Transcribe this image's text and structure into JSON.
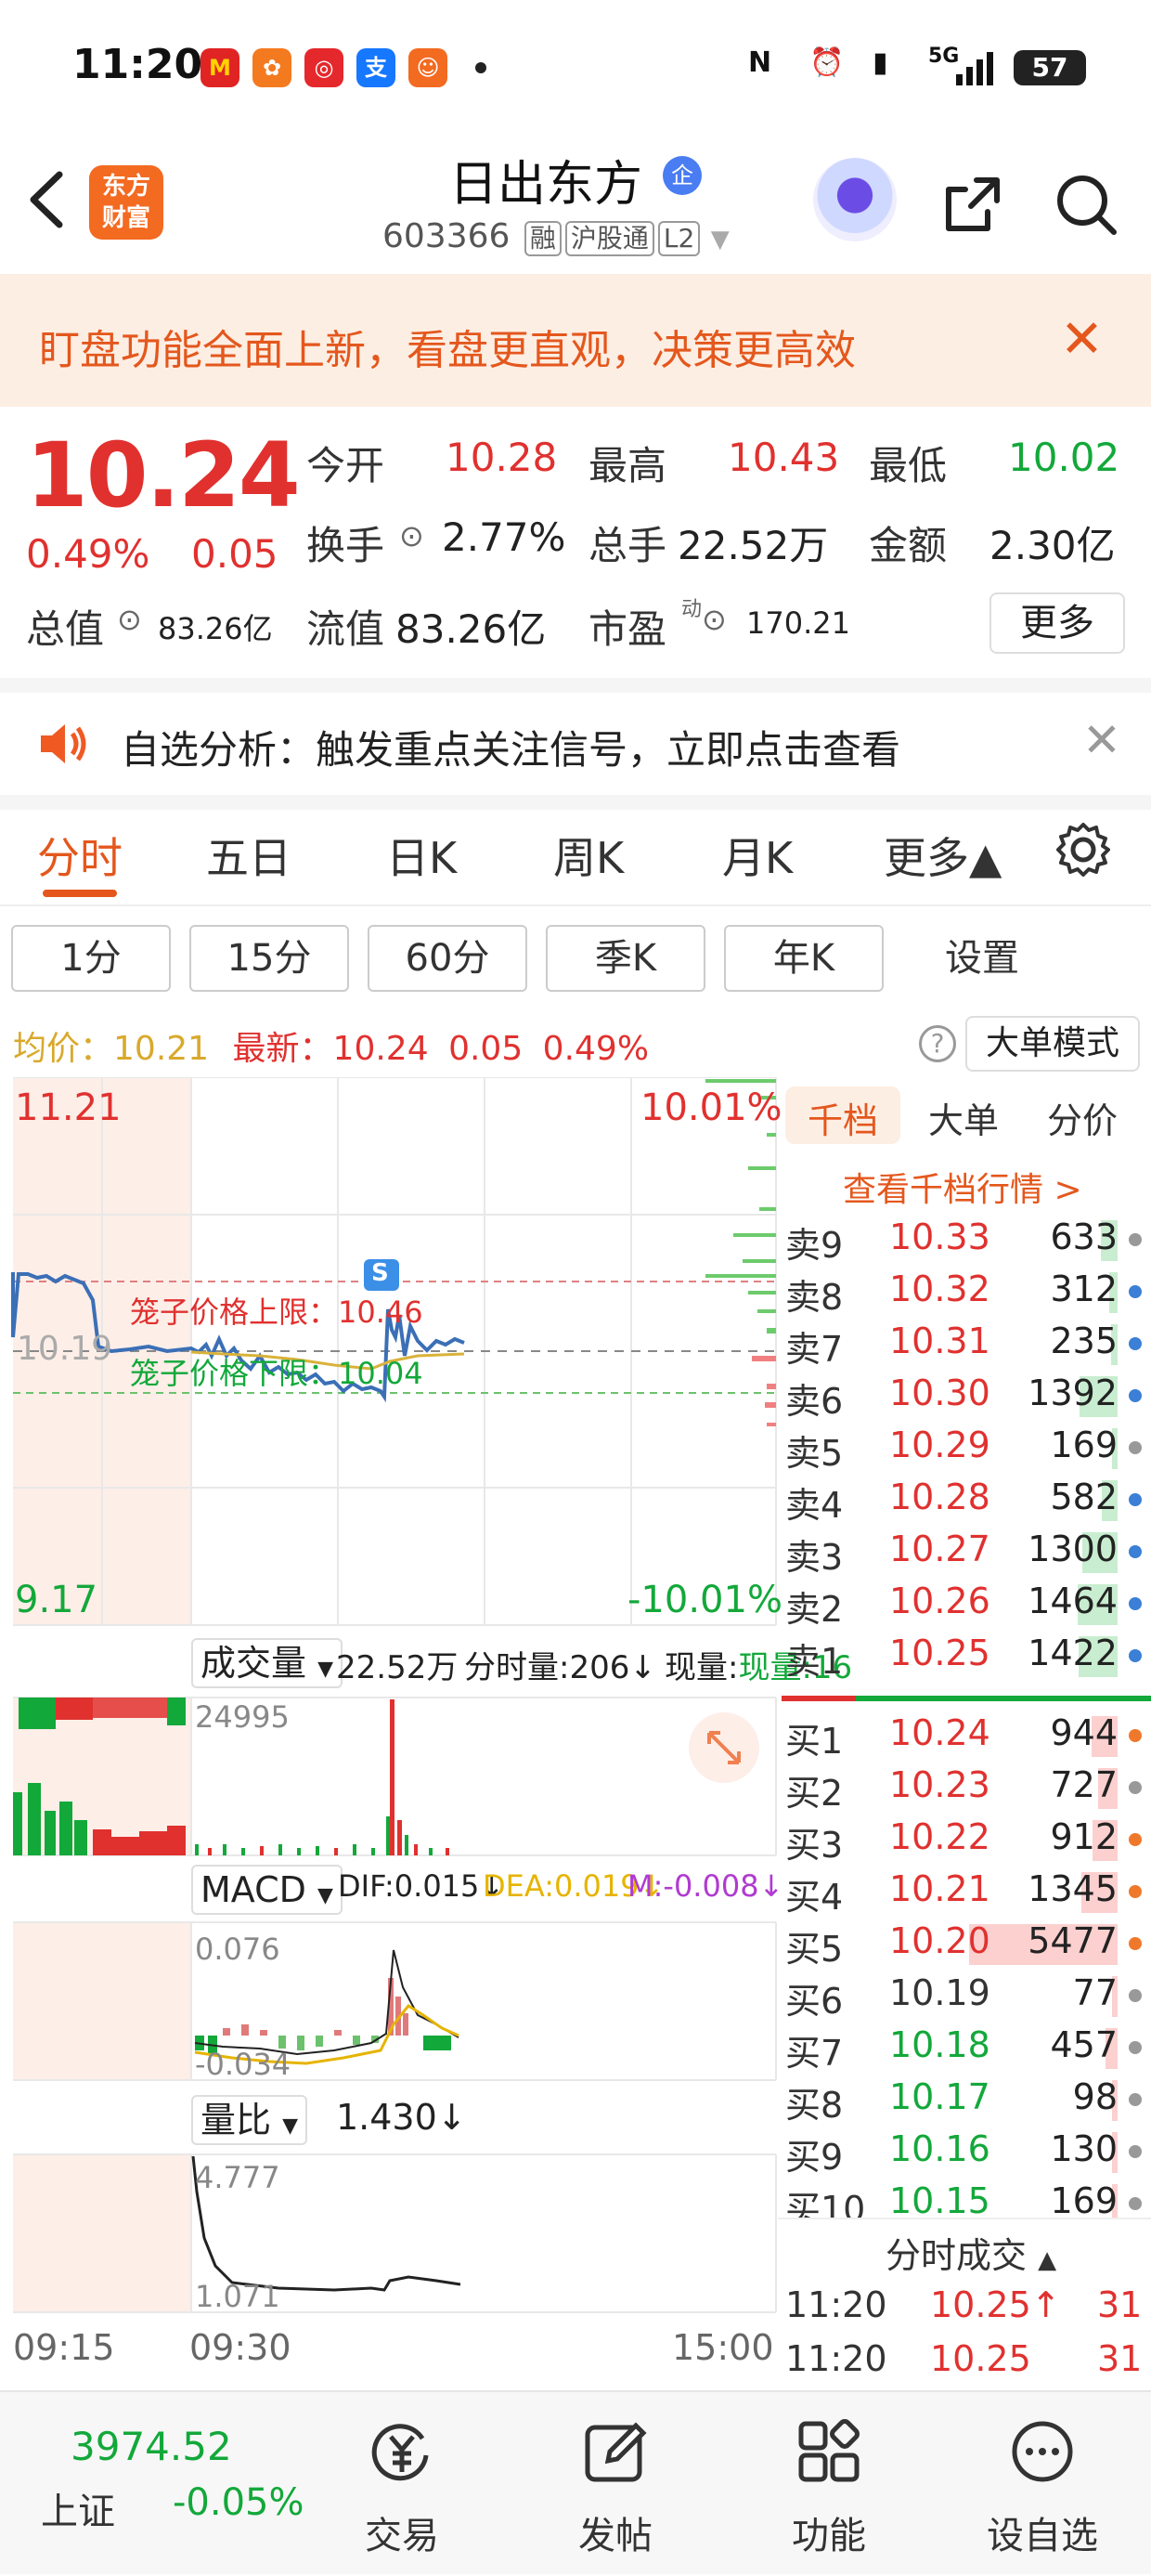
{
  "status_bar": {
    "time": "11:20",
    "battery": "57",
    "network": "5G"
  },
  "header": {
    "logo_text": [
      "东方",
      "财富"
    ],
    "stock_name": "日出东方",
    "badge": "企",
    "code": "603366",
    "tags": [
      "融",
      "沪股通",
      "L2"
    ]
  },
  "banner": {
    "text": "盯盘功能全面上新，看盘更直观，决策更高效"
  },
  "quote": {
    "price": "10.24",
    "pct": "0.49%",
    "change": "0.05",
    "open_label": "今开",
    "open": "10.28",
    "high_label": "最高",
    "high": "10.43",
    "low_label": "最低",
    "low": "10.02",
    "turnover_label": "换手",
    "turnover": "2.77%",
    "volume_label": "总手",
    "volume": "22.52万",
    "amount_label": "金额",
    "amount": "2.30亿",
    "mktcap_label": "总值",
    "mktcap": "83.26亿",
    "float_label": "流值",
    "float": "83.26亿",
    "pe_label": "市盈",
    "pe_sup": "动",
    "pe": "170.21",
    "more_label": "更多"
  },
  "notice": {
    "text": "自选分析：触发重点关注信号，立即点击查看"
  },
  "tabs": [
    "分时",
    "五日",
    "日K",
    "周K",
    "月K",
    "更多▲"
  ],
  "sub_tabs": [
    "1分",
    "15分",
    "60分",
    "季K",
    "年K",
    "设置"
  ],
  "avg_line": {
    "avg_label": "均价：",
    "avg": "10.21",
    "latest_label": "最新：",
    "latest": "10.24",
    "change": "0.05",
    "pct": "0.49%",
    "big_order_btn": "大单模式"
  },
  "chart": {
    "top_price": "11.21",
    "top_pct": "10.01%",
    "bottom_price": "9.17",
    "bottom_pct": "-10.01%",
    "prev_close": "10.19",
    "cage_upper": "笼子价格上限：10.46",
    "cage_lower": "笼子价格下限：10.04",
    "s_marker": "S",
    "vol_dropdown": "成交量",
    "vol_total": "22.52万",
    "vol_tick": "分时量:206↓",
    "vol_now": "现量:16",
    "vol_max": "24995",
    "macd_dropdown": "MACD",
    "dif": "DIF:0.015↓",
    "dea": "DEA:0.019↓",
    "m": "M:-0.008↓",
    "macd_max": "0.076",
    "macd_min": "-0.034",
    "lb_dropdown": "量比",
    "lb_value": "1.430↓",
    "lb_max": "4.777",
    "lb_min": "1.071",
    "time_start": "09:15",
    "time_open": "09:30",
    "time_end": "15:00"
  },
  "order_book": {
    "tabs": [
      "千档",
      "大单",
      "分价"
    ],
    "link": "查看千档行情 >",
    "asks": [
      {
        "label": "卖9",
        "price": "10.33",
        "vol": "633"
      },
      {
        "label": "卖8",
        "price": "10.32",
        "vol": "312"
      },
      {
        "label": "卖7",
        "price": "10.31",
        "vol": "235"
      },
      {
        "label": "卖6",
        "price": "10.30",
        "vol": "1392"
      },
      {
        "label": "卖5",
        "price": "10.29",
        "vol": "169"
      },
      {
        "label": "卖4",
        "price": "10.28",
        "vol": "582"
      },
      {
        "label": "卖3",
        "price": "10.27",
        "vol": "1300"
      },
      {
        "label": "卖2",
        "price": "10.26",
        "vol": "1464"
      },
      {
        "label": "卖1",
        "price": "10.25",
        "vol": "1422"
      }
    ],
    "bids": [
      {
        "label": "买1",
        "price": "10.24",
        "vol": "944"
      },
      {
        "label": "买2",
        "price": "10.23",
        "vol": "727"
      },
      {
        "label": "买3",
        "price": "10.22",
        "vol": "912"
      },
      {
        "label": "买4",
        "price": "10.21",
        "vol": "1345"
      },
      {
        "label": "买5",
        "price": "10.20",
        "vol": "5477"
      },
      {
        "label": "买6",
        "price": "10.19",
        "vol": "77"
      },
      {
        "label": "买7",
        "price": "10.18",
        "vol": "457"
      },
      {
        "label": "买8",
        "price": "10.17",
        "vol": "98"
      },
      {
        "label": "买9",
        "price": "10.16",
        "vol": "130"
      },
      {
        "label": "买10",
        "price": "10.15",
        "vol": "169"
      }
    ],
    "trades_title": "分时成交",
    "trades": [
      {
        "time": "11:20",
        "price": "10.25↑",
        "vol": "31"
      },
      {
        "time": "11:20",
        "price": "10.25",
        "vol": "31"
      }
    ]
  },
  "bottom_nav": {
    "index_value": "3974.52",
    "index_name": "上证",
    "index_pct": "-0.05%",
    "items": [
      "交易",
      "发帖",
      "功能",
      "设自选"
    ]
  },
  "colors": {
    "up": "#e0312f",
    "down": "#13a83a",
    "accent": "#e4571d",
    "price_line": "#3b6fb6",
    "avg_line": "#d9b23a"
  }
}
